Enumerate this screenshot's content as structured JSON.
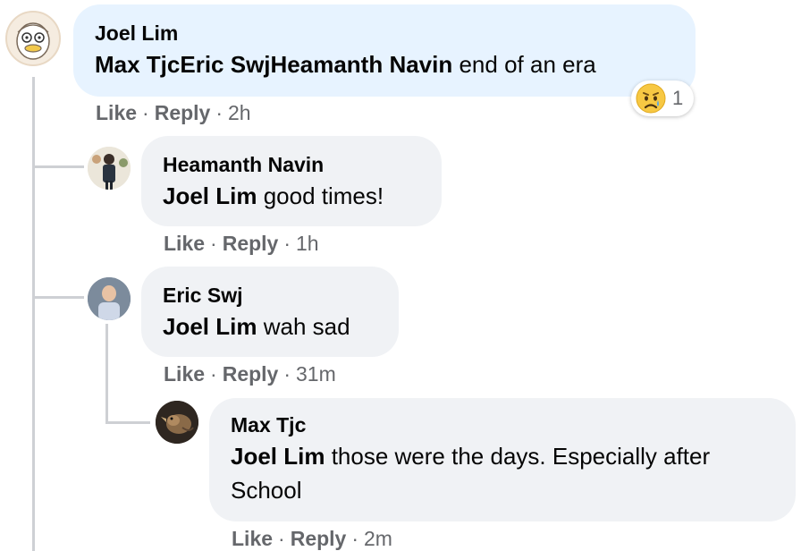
{
  "comments": [
    {
      "author": "Joel Lim",
      "mentions": "Max TjcEric SwjHeamanth Navin",
      "text": " end of an era",
      "actions": {
        "like": "Like",
        "reply": "Reply",
        "time": "2h"
      },
      "reaction": {
        "icon": "sad-face-icon",
        "count": "1"
      }
    },
    {
      "author": "Heamanth Navin",
      "mentions": "Joel Lim",
      "text": " good times!",
      "actions": {
        "like": "Like",
        "reply": "Reply",
        "time": "1h"
      }
    },
    {
      "author": "Eric Swj",
      "mentions": "Joel Lim",
      "text": " wah sad",
      "actions": {
        "like": "Like",
        "reply": "Reply",
        "time": "31m"
      }
    },
    {
      "author": "Max Tjc",
      "mentions": "Joel Lim",
      "text": " those were the days. Especially after School",
      "actions": {
        "like": "Like",
        "reply": "Reply",
        "time": "2m"
      }
    }
  ],
  "separator": "·",
  "colors": {
    "main_bubble": "#e7f3ff",
    "reply_bubble": "#f0f2f5",
    "thread_line": "#ced0d4",
    "meta_text": "#65676b"
  }
}
